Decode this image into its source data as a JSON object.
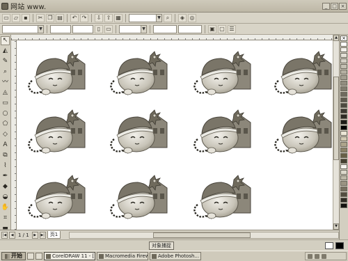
{
  "window": {
    "title": "网站 www."
  },
  "toolbar": {
    "zoom_combo": "",
    "unit_combo": ""
  },
  "pagebar": {
    "page_count": "1 / 1",
    "page_tab": "页1"
  },
  "statusbar": {
    "snap_button": "对象捕捉"
  },
  "taskbar": {
    "start_label": "开始",
    "tasks": [
      {
        "label": "CorelDRAW 11 - [..."
      },
      {
        "label": "Macromedia Firew..."
      },
      {
        "label": "Adobe Photosh..."
      }
    ]
  },
  "palette": {
    "colors": [
      "#ffffff",
      "#f2f0ea",
      "#e3e0d7",
      "#d4d0c5",
      "#c4c0b3",
      "#b3afa1",
      "#a29e90",
      "#918d7f",
      "#807c6e",
      "#6f6b5e",
      "#5e5a4e",
      "#4d4a3f",
      "#3d3a31",
      "#2d2b24",
      "#1e1c17",
      "#000000",
      "#ebe6d6",
      "#cfc8b1",
      "#ada58c",
      "#8a8268",
      "#676047",
      "#454030",
      "#f7f5ef",
      "#dcd8cb",
      "#bcb7a6",
      "#9a9483",
      "#767060",
      "#524d3f",
      "#2f2c24",
      "#141310"
    ]
  }
}
